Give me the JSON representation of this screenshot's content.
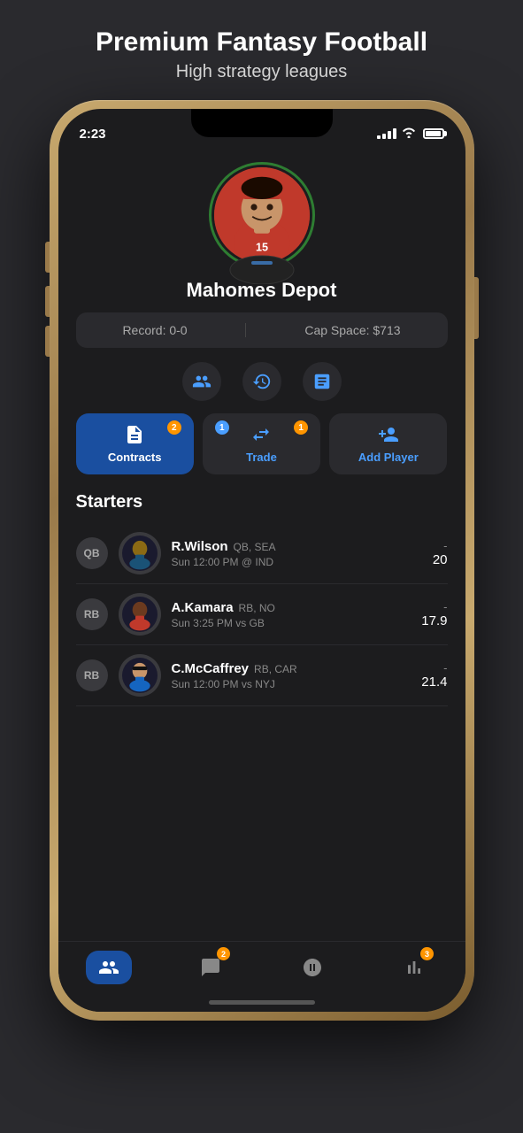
{
  "headline": {
    "title": "Premium Fantasy Football",
    "subtitle": "High strategy leagues"
  },
  "statusBar": {
    "time": "2:23",
    "batteryLevel": "85%"
  },
  "team": {
    "name": "Mahomes Depot",
    "record": "Record: 0-0",
    "capSpace": "Cap Space: $713"
  },
  "actionIcons": [
    {
      "name": "roster-icon",
      "label": "Roster"
    },
    {
      "name": "history-icon",
      "label": "History"
    },
    {
      "name": "notes-icon",
      "label": "Notes"
    }
  ],
  "buttons": [
    {
      "name": "contracts-button",
      "label": "Contracts",
      "badge": "2",
      "active": true
    },
    {
      "name": "trade-button",
      "label": "Trade",
      "badgeLeft": "1",
      "badgeRight": "1",
      "active": false
    },
    {
      "name": "add-player-button",
      "label": "Add Player",
      "active": false
    }
  ],
  "starters": {
    "title": "Starters",
    "players": [
      {
        "position": "QB",
        "firstName": "R.Wilson",
        "posTeam": "QB, SEA",
        "schedule": "Sun 12:00 PM @ IND",
        "scoreDash": "-",
        "score": "20"
      },
      {
        "position": "RB",
        "firstName": "A.Kamara",
        "posTeam": "RB, NO",
        "schedule": "Sun 3:25 PM vs GB",
        "scoreDash": "-",
        "score": "17.9"
      },
      {
        "position": "RB",
        "firstName": "C.McCaffrey",
        "posTeam": "RB, CAR",
        "schedule": "Sun 12:00 PM vs NYJ",
        "scoreDash": "-",
        "score": "21.4"
      }
    ]
  },
  "tabBar": {
    "tabs": [
      {
        "name": "roster-tab",
        "label": "Roster",
        "active": true,
        "badge": null
      },
      {
        "name": "messages-tab",
        "label": "Messages",
        "active": false,
        "badge": "2"
      },
      {
        "name": "scores-tab",
        "label": "Scores",
        "active": false,
        "badge": null
      },
      {
        "name": "standings-tab",
        "label": "Standings",
        "active": false,
        "badge": "3"
      }
    ]
  }
}
